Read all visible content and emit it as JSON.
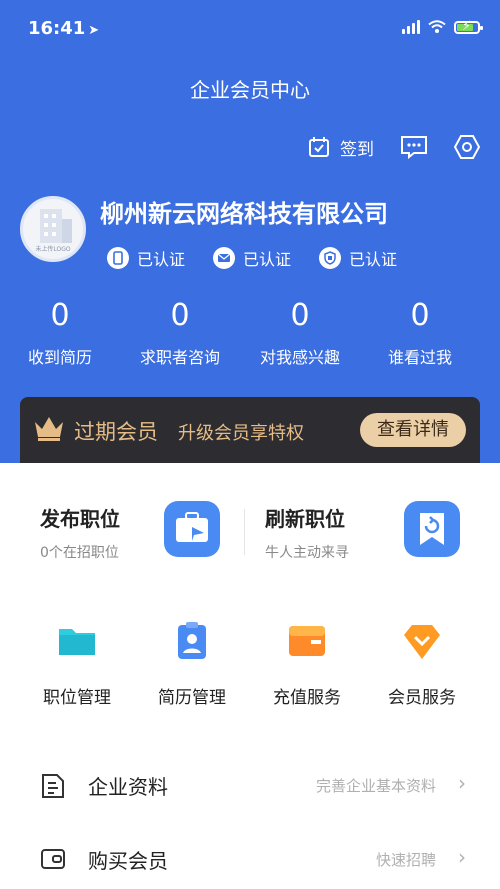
{
  "status_bar": {
    "time": "16:41"
  },
  "header": {
    "title": "企业会员中心",
    "checkin_label": "签到",
    "company_name": "柳州新云网络科技有限公司",
    "avatar_caption": "未上传LOGO",
    "verifications": [
      {
        "label": "已认证",
        "icon": "phone-icon"
      },
      {
        "label": "已认证",
        "icon": "mail-icon"
      },
      {
        "label": "已认证",
        "icon": "id-card-icon"
      }
    ],
    "stats": [
      {
        "value": "0",
        "label": "收到简历"
      },
      {
        "value": "0",
        "label": "求职者咨询"
      },
      {
        "value": "0",
        "label": "对我感兴趣"
      },
      {
        "value": "0",
        "label": "谁看过我"
      }
    ]
  },
  "vip_banner": {
    "status": "过期会员",
    "promo": "升级会员享特权",
    "button": "查看详情"
  },
  "actions": {
    "publish": {
      "title": "发布职位",
      "subtitle": "0个在招职位"
    },
    "refresh": {
      "title": "刷新职位",
      "subtitle": "牛人主动来寻"
    }
  },
  "grid": [
    {
      "label": "职位管理",
      "icon": "folder-icon"
    },
    {
      "label": "简历管理",
      "icon": "resume-icon"
    },
    {
      "label": "充值服务",
      "icon": "wallet-icon"
    },
    {
      "label": "会员服务",
      "icon": "vip-diamond-icon"
    }
  ],
  "list": [
    {
      "label": "企业资料",
      "hint": "完善企业基本资料",
      "icon": "document-icon"
    },
    {
      "label": "购买会员",
      "hint": "快速招聘",
      "icon": "card-icon"
    }
  ],
  "colors": {
    "header_bg": "#3b6ee0",
    "vip_bg": "#2c2c31",
    "vip_gold": "#e6bc86",
    "button_gold": "#ebcfa6"
  }
}
